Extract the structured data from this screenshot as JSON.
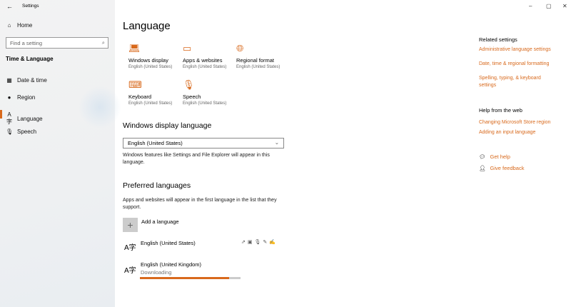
{
  "window": {
    "title": "Settings",
    "back_icon": "←",
    "minimize": "–",
    "maximize": "▢",
    "close": "✕"
  },
  "sidebar": {
    "home": "Home",
    "search_placeholder": "Find a setting",
    "section": "Time & Language",
    "items": [
      {
        "label": "Date & time",
        "icon": "calendar-icon"
      },
      {
        "label": "Region",
        "icon": "globe-icon"
      },
      {
        "label": "Language",
        "icon": "language-icon"
      },
      {
        "label": "Speech",
        "icon": "microphone-icon"
      }
    ],
    "active": "Language"
  },
  "main": {
    "title": "Language",
    "tiles": [
      {
        "label": "Windows display",
        "sub": "English (United States)"
      },
      {
        "label": "Apps & websites",
        "sub": "English (United States)"
      },
      {
        "label": "Regional format",
        "sub": "English (United States)"
      },
      {
        "label": "Keyboard",
        "sub": "English (United States)"
      },
      {
        "label": "Speech",
        "sub": "English (United States)"
      }
    ],
    "display_heading": "Windows display language",
    "display_value": "English (United States)",
    "display_desc": "Windows features like Settings and File Explorer will appear in this language.",
    "preferred_heading": "Preferred languages",
    "preferred_desc": "Apps and websites will appear in the first language in the list that they support.",
    "add_language": "Add a language",
    "languages": [
      {
        "name": "English (United States)"
      },
      {
        "name": "English (United Kingdom)",
        "status": "Downloading",
        "progress": 0.89
      }
    ]
  },
  "related": {
    "heading": "Related settings",
    "links": [
      "Administrative language settings",
      "Date, time & regional formatting",
      "Spelling, typing, & keyboard settings"
    ],
    "help_heading": "Help from the web",
    "help_links": [
      "Changing Microsoft Store region",
      "Adding an input language"
    ],
    "get_help": "Get help",
    "feedback": "Give feedback"
  },
  "colors": {
    "accent": "#d8691c"
  }
}
